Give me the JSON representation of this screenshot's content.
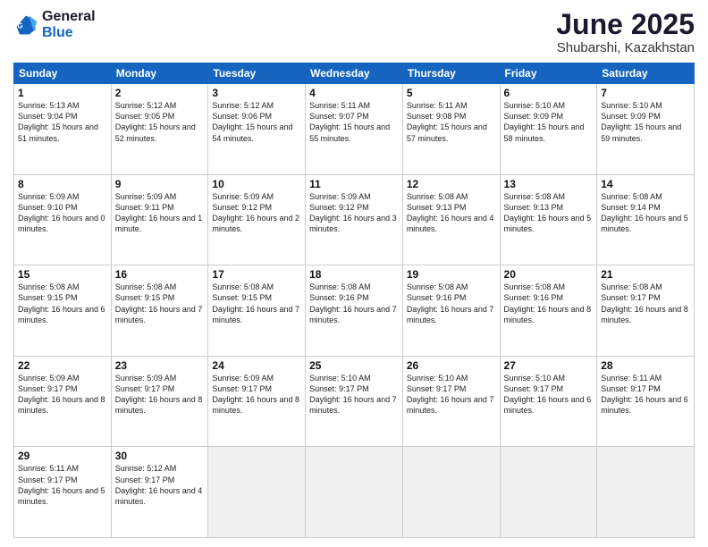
{
  "logo": {
    "general": "General",
    "blue": "Blue"
  },
  "title": "June 2025",
  "subtitle": "Shubarshi, Kazakhstan",
  "headers": [
    "Sunday",
    "Monday",
    "Tuesday",
    "Wednesday",
    "Thursday",
    "Friday",
    "Saturday"
  ],
  "days": [
    {
      "num": "",
      "empty": true
    },
    {
      "num": "",
      "empty": true
    },
    {
      "num": "",
      "empty": true
    },
    {
      "num": "",
      "empty": true
    },
    {
      "num": "",
      "empty": true
    },
    {
      "num": "",
      "empty": true
    },
    {
      "num": "",
      "empty": true
    },
    {
      "num": "1",
      "sunrise": "5:13 AM",
      "sunset": "9:04 PM",
      "daylight": "15 hours and 51 minutes."
    },
    {
      "num": "2",
      "sunrise": "5:12 AM",
      "sunset": "9:05 PM",
      "daylight": "15 hours and 52 minutes."
    },
    {
      "num": "3",
      "sunrise": "5:12 AM",
      "sunset": "9:06 PM",
      "daylight": "15 hours and 54 minutes."
    },
    {
      "num": "4",
      "sunrise": "5:11 AM",
      "sunset": "9:07 PM",
      "daylight": "15 hours and 55 minutes."
    },
    {
      "num": "5",
      "sunrise": "5:11 AM",
      "sunset": "9:08 PM",
      "daylight": "15 hours and 57 minutes."
    },
    {
      "num": "6",
      "sunrise": "5:10 AM",
      "sunset": "9:09 PM",
      "daylight": "15 hours and 58 minutes."
    },
    {
      "num": "7",
      "sunrise": "5:10 AM",
      "sunset": "9:09 PM",
      "daylight": "15 hours and 59 minutes."
    },
    {
      "num": "8",
      "sunrise": "5:09 AM",
      "sunset": "9:10 PM",
      "daylight": "16 hours and 0 minutes."
    },
    {
      "num": "9",
      "sunrise": "5:09 AM",
      "sunset": "9:11 PM",
      "daylight": "16 hours and 1 minute."
    },
    {
      "num": "10",
      "sunrise": "5:09 AM",
      "sunset": "9:12 PM",
      "daylight": "16 hours and 2 minutes."
    },
    {
      "num": "11",
      "sunrise": "5:09 AM",
      "sunset": "9:12 PM",
      "daylight": "16 hours and 3 minutes."
    },
    {
      "num": "12",
      "sunrise": "5:08 AM",
      "sunset": "9:13 PM",
      "daylight": "16 hours and 4 minutes."
    },
    {
      "num": "13",
      "sunrise": "5:08 AM",
      "sunset": "9:13 PM",
      "daylight": "16 hours and 5 minutes."
    },
    {
      "num": "14",
      "sunrise": "5:08 AM",
      "sunset": "9:14 PM",
      "daylight": "16 hours and 5 minutes."
    },
    {
      "num": "15",
      "sunrise": "5:08 AM",
      "sunset": "9:15 PM",
      "daylight": "16 hours and 6 minutes."
    },
    {
      "num": "16",
      "sunrise": "5:08 AM",
      "sunset": "9:15 PM",
      "daylight": "16 hours and 7 minutes."
    },
    {
      "num": "17",
      "sunrise": "5:08 AM",
      "sunset": "9:15 PM",
      "daylight": "16 hours and 7 minutes."
    },
    {
      "num": "18",
      "sunrise": "5:08 AM",
      "sunset": "9:16 PM",
      "daylight": "16 hours and 7 minutes."
    },
    {
      "num": "19",
      "sunrise": "5:08 AM",
      "sunset": "9:16 PM",
      "daylight": "16 hours and 7 minutes."
    },
    {
      "num": "20",
      "sunrise": "5:08 AM",
      "sunset": "9:16 PM",
      "daylight": "16 hours and 8 minutes."
    },
    {
      "num": "21",
      "sunrise": "5:08 AM",
      "sunset": "9:17 PM",
      "daylight": "16 hours and 8 minutes."
    },
    {
      "num": "22",
      "sunrise": "5:09 AM",
      "sunset": "9:17 PM",
      "daylight": "16 hours and 8 minutes."
    },
    {
      "num": "23",
      "sunrise": "5:09 AM",
      "sunset": "9:17 PM",
      "daylight": "16 hours and 8 minutes."
    },
    {
      "num": "24",
      "sunrise": "5:09 AM",
      "sunset": "9:17 PM",
      "daylight": "16 hours and 8 minutes."
    },
    {
      "num": "25",
      "sunrise": "5:10 AM",
      "sunset": "9:17 PM",
      "daylight": "16 hours and 7 minutes."
    },
    {
      "num": "26",
      "sunrise": "5:10 AM",
      "sunset": "9:17 PM",
      "daylight": "16 hours and 7 minutes."
    },
    {
      "num": "27",
      "sunrise": "5:10 AM",
      "sunset": "9:17 PM",
      "daylight": "16 hours and 6 minutes."
    },
    {
      "num": "28",
      "sunrise": "5:11 AM",
      "sunset": "9:17 PM",
      "daylight": "16 hours and 6 minutes."
    },
    {
      "num": "29",
      "sunrise": "5:11 AM",
      "sunset": "9:17 PM",
      "daylight": "16 hours and 5 minutes."
    },
    {
      "num": "30",
      "sunrise": "5:12 AM",
      "sunset": "9:17 PM",
      "daylight": "16 hours and 4 minutes."
    },
    {
      "num": "",
      "empty": true
    },
    {
      "num": "",
      "empty": true
    },
    {
      "num": "",
      "empty": true
    },
    {
      "num": "",
      "empty": true
    },
    {
      "num": "",
      "empty": true
    }
  ]
}
